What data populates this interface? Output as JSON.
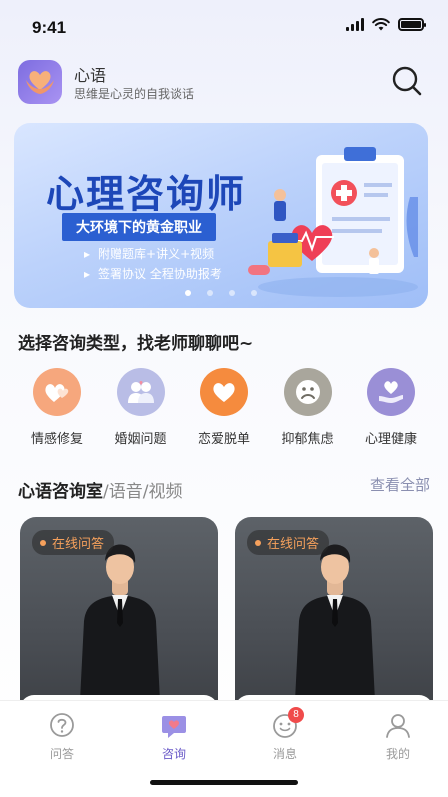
{
  "status_bar": {
    "time": "9:41"
  },
  "header": {
    "app_name": "心语",
    "slogan": "思维是心灵的自我谈话",
    "search_icon": "search-icon",
    "logo_icon": "heart-hands-logo"
  },
  "banner": {
    "title": "心理咨询师",
    "subtitle": "大环境下的黄金职业",
    "bullets": [
      "附赠题库+讲义+视频",
      "签署协议 全程协助报考"
    ],
    "slide_count": 4,
    "active_slide": 1
  },
  "prompt": "选择咨询类型，找老师聊聊吧~",
  "categories": [
    {
      "label": "情感修复",
      "icon": "hearts-icon",
      "color": "#f6a77d"
    },
    {
      "label": "婚姻问题",
      "icon": "couple-icon",
      "color": "#b9bde6"
    },
    {
      "label": "恋爱脱单",
      "icon": "heart-icon",
      "color": "#f58b3e"
    },
    {
      "label": "抑郁焦虑",
      "icon": "sad-face-icon",
      "color": "#a9a69c"
    },
    {
      "label": "心理健康",
      "icon": "heart-hand-icon",
      "color": "#9a8fd6"
    }
  ],
  "section": {
    "title_main": "心语咨询室",
    "title_sub": "/语音/视频",
    "more": "查看全部"
  },
  "cards": [
    {
      "badge": "在线问答"
    },
    {
      "badge": "在线问答"
    }
  ],
  "tabbar": {
    "tabs": [
      {
        "label": "问答",
        "icon": "question-icon"
      },
      {
        "label": "咨询",
        "icon": "heart-chat-icon",
        "active": true
      },
      {
        "label": "消息",
        "icon": "message-icon",
        "badge": "8"
      },
      {
        "label": "我的",
        "icon": "user-icon"
      }
    ]
  },
  "colors": {
    "accent": "#6a5ac8",
    "banner_blue": "#1d47b8",
    "badge_orange": "#f6a15c"
  }
}
